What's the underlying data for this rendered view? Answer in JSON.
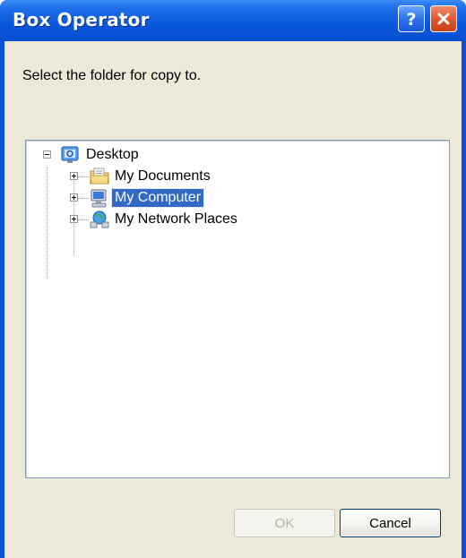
{
  "window": {
    "title": "Box Operator",
    "help_icon": "question-mark",
    "close_icon": "x-mark"
  },
  "prompt": "Select the folder for copy to.",
  "tree": {
    "root": {
      "label": "Desktop",
      "icon": "desktop-icon",
      "expanded": true
    },
    "children": [
      {
        "label": "My Documents",
        "icon": "folder-documents-icon",
        "expanded": false,
        "selected": false
      },
      {
        "label": "My Computer",
        "icon": "computer-icon",
        "expanded": false,
        "selected": true
      },
      {
        "label": "My Network Places",
        "icon": "network-places-icon",
        "expanded": false,
        "selected": false
      }
    ]
  },
  "buttons": {
    "ok_label": "OK",
    "ok_enabled": false,
    "cancel_label": "Cancel"
  },
  "colors": {
    "title_bar": "#0a56dc",
    "dialog_bg": "#ece9d8",
    "selection": "#316ac5",
    "close_button": "#e05a30"
  }
}
